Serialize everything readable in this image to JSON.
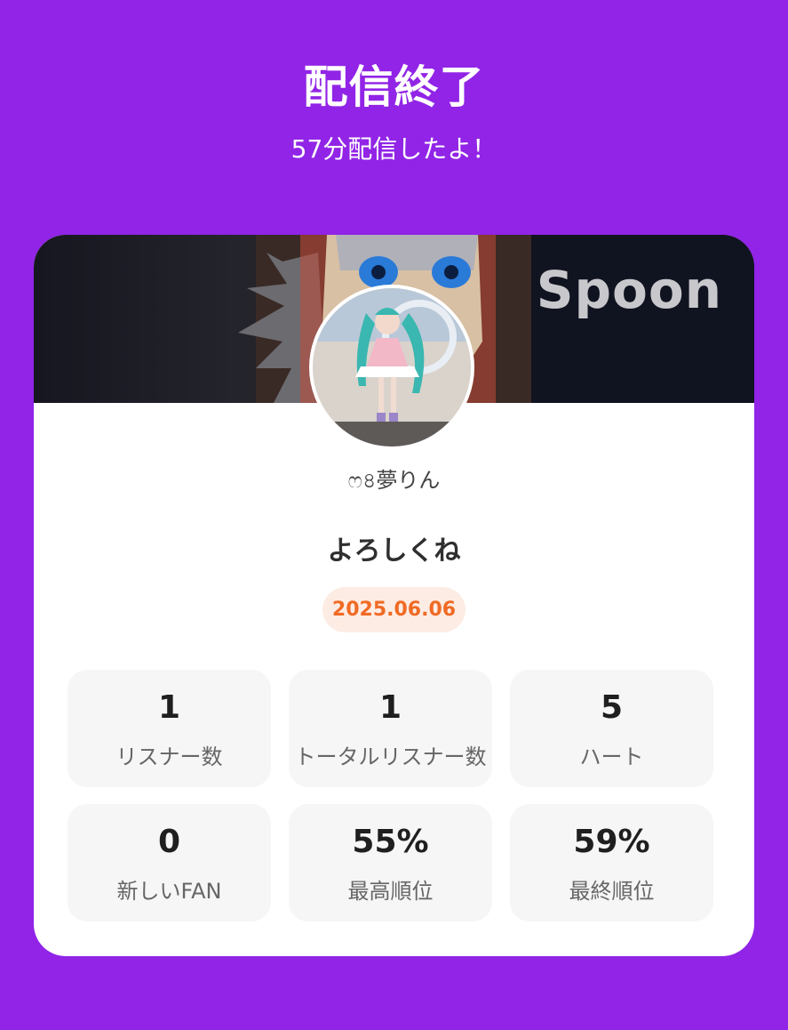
{
  "header": {
    "title": "配信終了",
    "subtitle": "57分配信したよ！"
  },
  "card": {
    "brand": "Spoon",
    "user_name": "ෆ৪夢りん",
    "message": "よろしくね",
    "date": "2025.06.06",
    "stats": [
      {
        "value": "1",
        "label": "リスナー数"
      },
      {
        "value": "1",
        "label": "トータルリスナー数"
      },
      {
        "value": "5",
        "label": "ハート"
      },
      {
        "value": "0",
        "label": "新しいFAN"
      },
      {
        "value": "55%",
        "label": "最高順位"
      },
      {
        "value": "59%",
        "label": "最終順位"
      }
    ]
  },
  "colors": {
    "background": "#9124e6",
    "card": "#ffffff",
    "date_text": "#f06a24",
    "date_bg": "#fdece4",
    "stat_bg": "#f6f6f6"
  }
}
